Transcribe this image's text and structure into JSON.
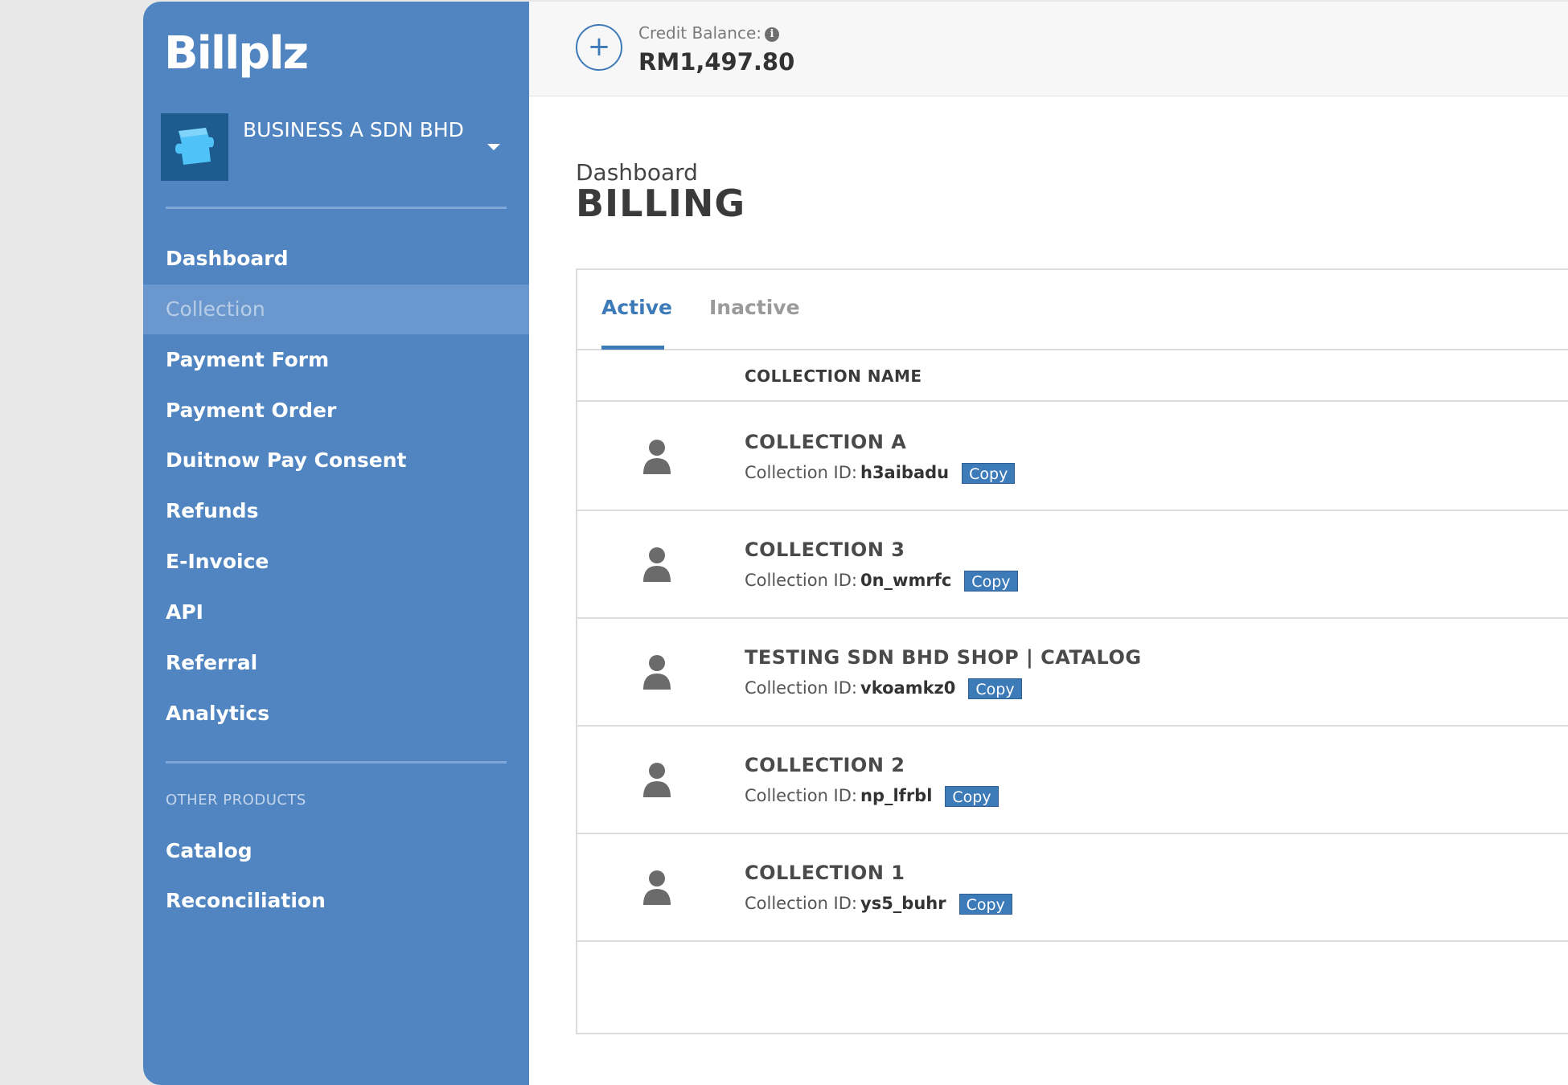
{
  "brand": {
    "logo": "Billplz"
  },
  "account": {
    "name": "BUSINESS A SDN BHD"
  },
  "sidebar": {
    "items": [
      {
        "label": "Dashboard"
      },
      {
        "label": "Collection"
      },
      {
        "label": "Payment Form"
      },
      {
        "label": "Payment Order"
      },
      {
        "label": "Duitnow Pay Consent"
      },
      {
        "label": "Refunds"
      },
      {
        "label": "E-Invoice"
      },
      {
        "label": "API"
      },
      {
        "label": "Referral"
      },
      {
        "label": "Analytics"
      }
    ],
    "other_products_label": "OTHER PRODUCTS",
    "other_products": [
      {
        "label": "Catalog"
      },
      {
        "label": "Reconciliation"
      }
    ]
  },
  "topbar": {
    "add_icon": "plus-icon",
    "credit_label": "Credit Balance:",
    "credit_value": "RM1,497.80"
  },
  "page": {
    "breadcrumb": "Dashboard",
    "title": "BILLING"
  },
  "tabs": [
    {
      "label": "Active"
    },
    {
      "label": "Inactive"
    }
  ],
  "table": {
    "header": "COLLECTION NAME",
    "id_prefix": "Collection ID:",
    "copy_label": "Copy",
    "rows": [
      {
        "name": "COLLECTION A",
        "id": "h3aibadu"
      },
      {
        "name": "COLLECTION 3",
        "id": "0n_wmrfc"
      },
      {
        "name": "TESTING SDN BHD SHOP | CATALOG",
        "id": "vkoamkz0"
      },
      {
        "name": "COLLECTION 2",
        "id": "np_lfrbl"
      },
      {
        "name": "COLLECTION 1",
        "id": "ys5_buhr"
      }
    ]
  },
  "colors": {
    "sidebar": "#5185c1",
    "accent": "#3d7ab8"
  }
}
